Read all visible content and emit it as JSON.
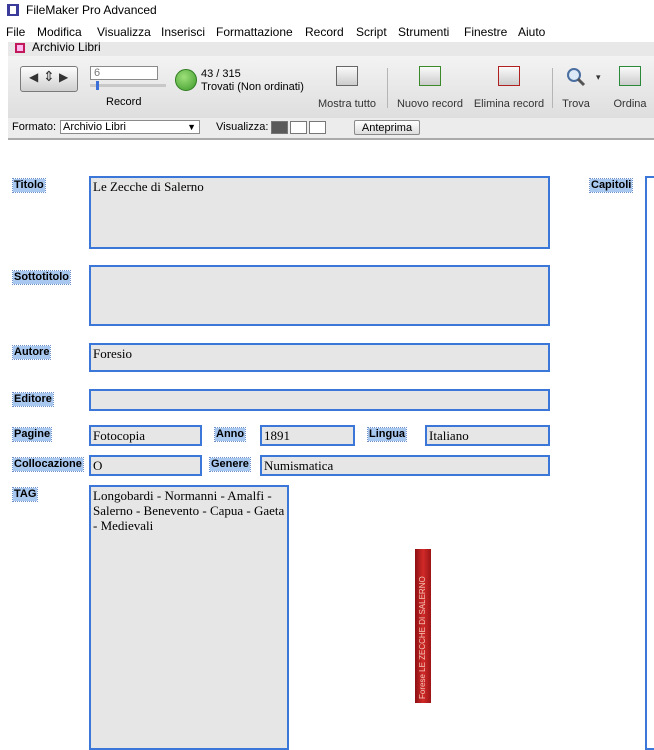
{
  "window": {
    "app_title": "FileMaker Pro Advanced"
  },
  "menu": [
    "File",
    "Modifica",
    "Visualizza",
    "Inserisci",
    "Formattazione",
    "Record",
    "Script",
    "Strumenti",
    "Finestre",
    "Aiuto"
  ],
  "document": {
    "tab_title": "Archivio Libri"
  },
  "toolbar": {
    "record_number": "6",
    "record_label": "Record",
    "found_count": "43 / 315",
    "found_status": "Trovati (Non ordinati)",
    "show_all": "Mostra tutto",
    "new_record": "Nuovo record",
    "delete_record": "Elimina record",
    "find": "Trova",
    "sort": "Ordina"
  },
  "layoutbar": {
    "format_label": "Formato:",
    "format_value": "Archivio Libri",
    "view_label": "Visualizza:",
    "preview_button": "Anteprima"
  },
  "fields": {
    "titolo": {
      "label": "Titolo",
      "value": "Le Zecche di Salerno"
    },
    "sottotitolo": {
      "label": "Sottotitolo",
      "value": ""
    },
    "autore": {
      "label": "Autore",
      "value": "Foresio"
    },
    "editore": {
      "label": "Editore",
      "value": ""
    },
    "pagine": {
      "label": "Pagine",
      "value": "Fotocopia"
    },
    "anno": {
      "label": "Anno",
      "value": "1891"
    },
    "lingua": {
      "label": "Lingua",
      "value": "Italiano"
    },
    "collocazione": {
      "label": "Collocazione",
      "value": "O"
    },
    "genere": {
      "label": "Genere",
      "value": "Numismatica"
    },
    "tag": {
      "label": "TAG",
      "value": "Longobardi - Normanni - Amalfi - Salerno - Benevento - Capua - Gaeta - Medievali"
    },
    "capitoli": {
      "label": "Capitoli",
      "value": ""
    }
  },
  "book_spine": {
    "text": "Forese LE ZECCHE DI SALERNO"
  }
}
